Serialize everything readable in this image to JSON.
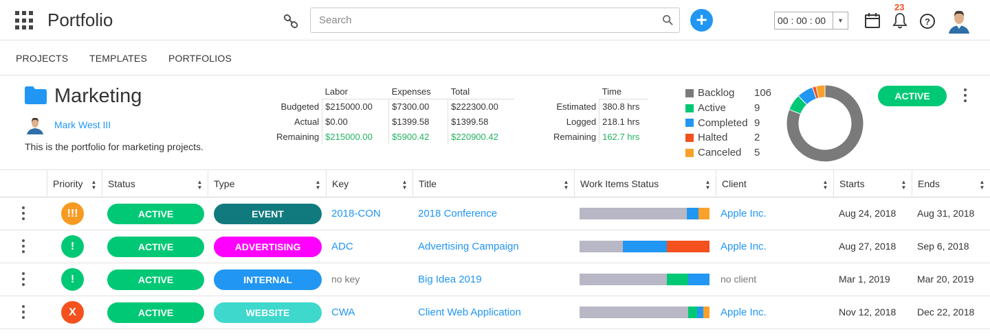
{
  "app": {
    "title": "Portfolio"
  },
  "search": {
    "placeholder": "Search"
  },
  "timer": {
    "value": "00 : 00 : 00"
  },
  "notifications": {
    "count": "23"
  },
  "nav": {
    "projects": "PROJECTS",
    "templates": "TEMPLATES",
    "portfolios": "PORTFOLIOS"
  },
  "portfolio": {
    "name": "Marketing",
    "owner": "Mark West III",
    "description": "This is the portfolio for marketing projects.",
    "status": "ACTIVE"
  },
  "financials": {
    "headers": [
      "Labor",
      "Expenses",
      "Total"
    ],
    "rows": [
      {
        "label": "Budgeted",
        "labor": "$215000.00",
        "expenses": "$7300.00",
        "total": "$222300.00"
      },
      {
        "label": "Actual",
        "labor": "$0.00",
        "expenses": "$1399.58",
        "total": "$1399.58"
      },
      {
        "label": "Remaining",
        "labor": "$215000.00",
        "expenses": "$5900.42",
        "total": "$220900.42"
      }
    ]
  },
  "time": {
    "header": "Time",
    "rows": [
      {
        "label": "Estimated",
        "value": "380.8 hrs"
      },
      {
        "label": "Logged",
        "value": "218.1 hrs"
      },
      {
        "label": "Remaining",
        "value": "162.7 hrs"
      }
    ]
  },
  "chart_data": {
    "type": "pie",
    "donut": true,
    "categories": [
      "Backlog",
      "Active",
      "Completed",
      "Halted",
      "Canceled"
    ],
    "values": [
      106,
      9,
      9,
      2,
      5
    ],
    "colors": [
      "#7a7a7a",
      "#00c875",
      "#2196f3",
      "#f4511e",
      "#f9a12a"
    ],
    "legend": "left"
  },
  "table": {
    "columns": [
      "Priority",
      "Status",
      "Type",
      "Key",
      "Title",
      "Work Items Status",
      "Client",
      "Starts",
      "Ends"
    ],
    "rows": [
      {
        "priority": "!!!",
        "priority_color": "#f79a22",
        "status": "ACTIVE",
        "type": "EVENT",
        "type_color": "#117a7e",
        "key": "2018-CON",
        "title": "2018 Conference",
        "work": [
          {
            "color": "#b8b7c5",
            "fraction": 0.825
          },
          {
            "color": "#2196f3",
            "fraction": 0.09
          },
          {
            "color": "#f9a12a",
            "fraction": 0.085
          }
        ],
        "client": "Apple Inc.",
        "starts": "Aug 24, 2018",
        "ends": "Aug 31, 2018"
      },
      {
        "priority": "!",
        "priority_color": "#00c875",
        "status": "ACTIVE",
        "type": "ADVERTISING",
        "type_color": "#ff00ff",
        "key": "ADC",
        "title": "Advertising Campaign",
        "work": [
          {
            "color": "#b8b7c5",
            "fraction": 0.335
          },
          {
            "color": "#2196f3",
            "fraction": 0.335
          },
          {
            "color": "#f4511e",
            "fraction": 0.33
          }
        ],
        "client": "Apple Inc.",
        "starts": "Aug 27, 2018",
        "ends": "Sep 6, 2018"
      },
      {
        "priority": "!",
        "priority_color": "#00c875",
        "status": "ACTIVE",
        "type": "INTERNAL",
        "type_color": "#2196f3",
        "key": "no key",
        "title": "Big Idea 2019",
        "work": [
          {
            "color": "#b8b7c5",
            "fraction": 0.67
          },
          {
            "color": "#00c875",
            "fraction": 0.165
          },
          {
            "color": "#2196f3",
            "fraction": 0.165
          }
        ],
        "client": "no client",
        "starts": "Mar 1, 2019",
        "ends": "Mar 20, 2019"
      },
      {
        "priority": "X",
        "priority_color": "#f4511e",
        "status": "ACTIVE",
        "type": "WEBSITE",
        "type_color": "#3ed8cc",
        "key": "CWA",
        "title": "Client Web Application",
        "work": [
          {
            "color": "#b8b7c5",
            "fraction": 0.835
          },
          {
            "color": "#00c875",
            "fraction": 0.07
          },
          {
            "color": "#2196f3",
            "fraction": 0.05
          },
          {
            "color": "#f9a12a",
            "fraction": 0.045
          }
        ],
        "client": "Apple Inc.",
        "starts": "Nov 12, 2018",
        "ends": "Dec 22, 2018"
      }
    ]
  }
}
